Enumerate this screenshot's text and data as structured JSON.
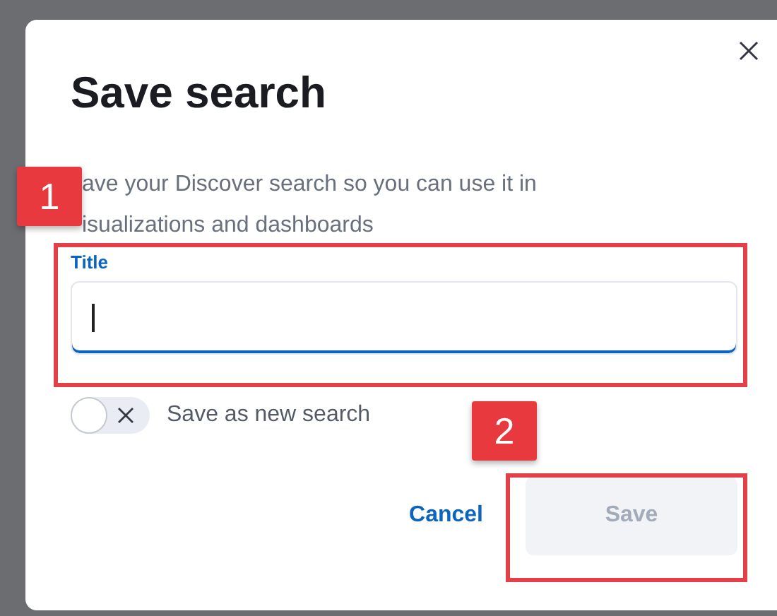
{
  "dialog": {
    "title": "Save search",
    "description_lines": [
      "ave your Discover search so you can use it in",
      "isualizations and dashboards"
    ]
  },
  "field": {
    "label": "Title",
    "focused": true
  },
  "toggle": {
    "label": "Save as new search",
    "on": false
  },
  "buttons": [
    {
      "label": "Cancel",
      "kind": "link",
      "disabled": false
    },
    {
      "label": "Save",
      "kind": "primary",
      "disabled": true
    }
  ],
  "callouts": [
    {
      "number": "1"
    },
    {
      "number": "2"
    }
  ]
}
